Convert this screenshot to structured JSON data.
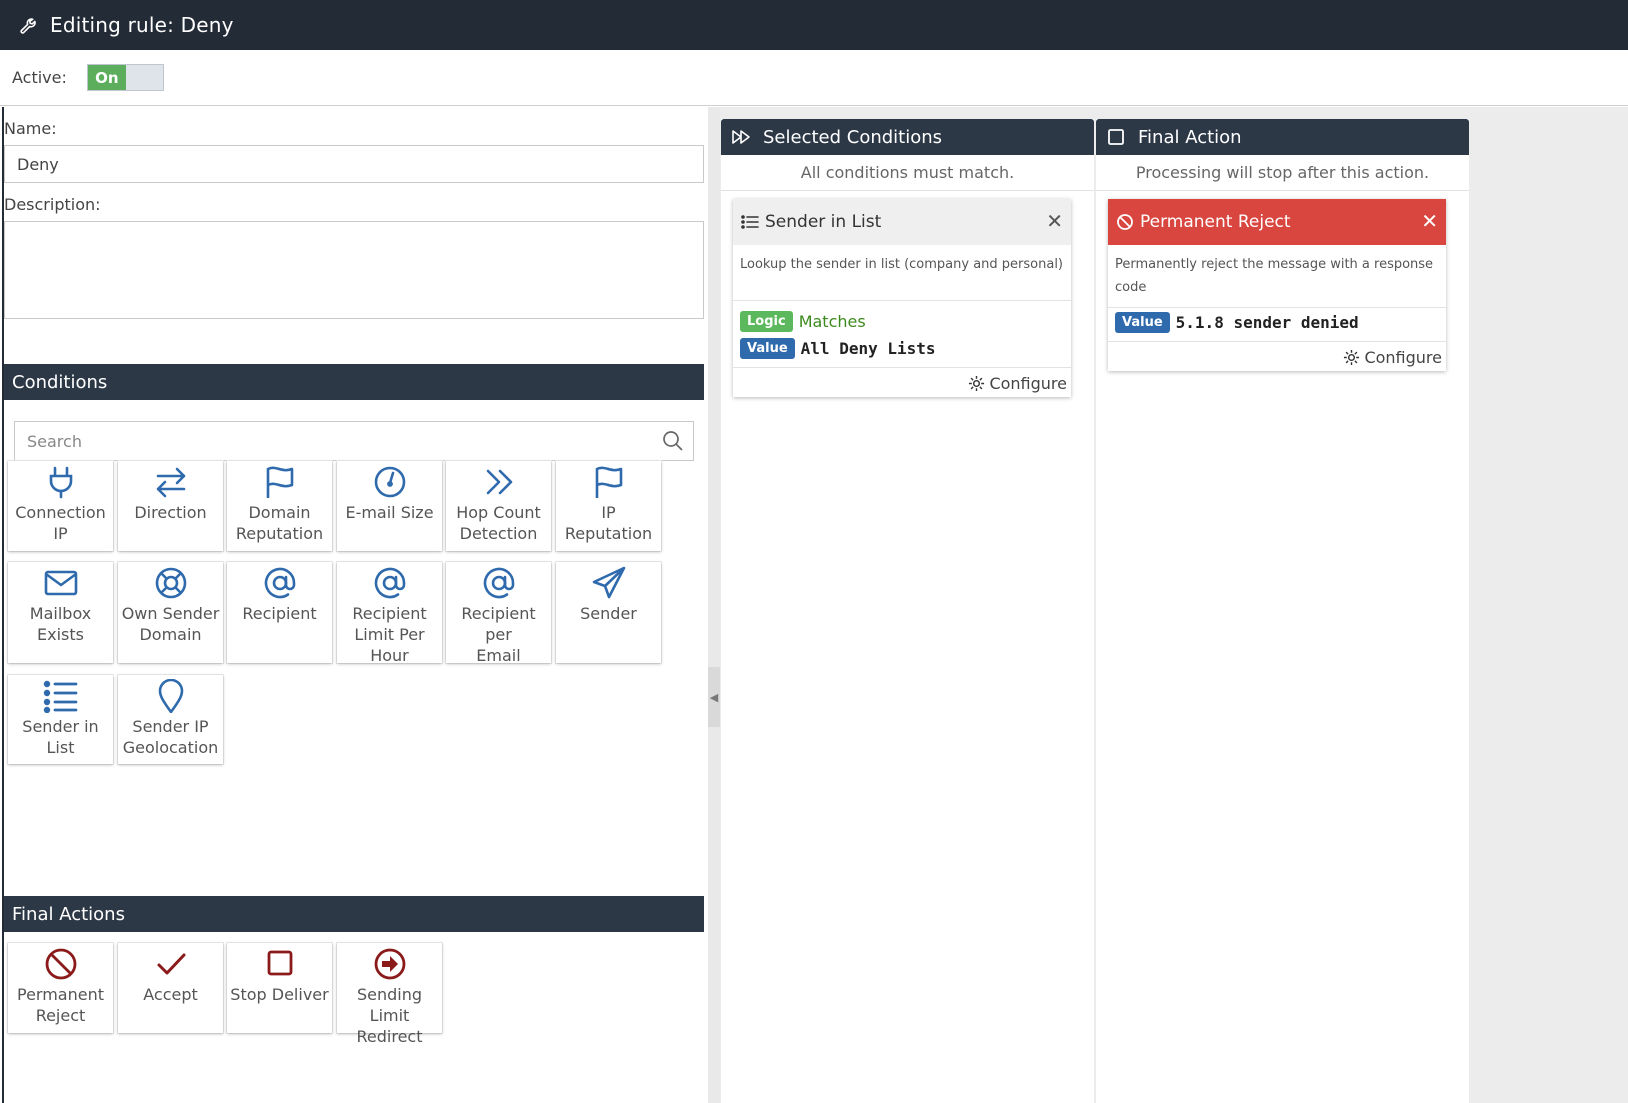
{
  "header": {
    "title": "Editing rule: Deny",
    "icon": "wrench-icon"
  },
  "active": {
    "label": "Active:",
    "toggle_on": "On"
  },
  "form": {
    "name_label": "Name:",
    "name_value": "Deny",
    "description_label": "Description:",
    "description_value": ""
  },
  "conditions": {
    "heading": "Conditions",
    "search_placeholder": "Search",
    "tiles": [
      {
        "l1": "Connection",
        "l2": "IP",
        "icon": "plug-icon"
      },
      {
        "l1": "Direction",
        "l2": "",
        "icon": "arrows-exchange-icon"
      },
      {
        "l1": "Domain",
        "l2": "Reputation",
        "icon": "flag-icon"
      },
      {
        "l1": "E-mail Size",
        "l2": "",
        "icon": "gauge-icon"
      },
      {
        "l1": "Hop Count",
        "l2": "Detection",
        "icon": "double-chevron-right-icon"
      },
      {
        "l1": "IP Reputation",
        "l2": "",
        "icon": "flag-icon"
      },
      {
        "l1": "Mailbox",
        "l2": "Exists",
        "icon": "envelope-icon"
      },
      {
        "l1": "Own Sender",
        "l2": "Domain",
        "icon": "lifebuoy-icon"
      },
      {
        "l1": "Recipient",
        "l2": "",
        "icon": "at-icon"
      },
      {
        "l1": "Recipient",
        "l2": "Limit Per",
        "l3": "Hour",
        "icon": "at-icon"
      },
      {
        "l1": "Recipient per",
        "l2": "Email",
        "icon": "at-icon"
      },
      {
        "l1": "Sender",
        "l2": "",
        "icon": "paper-plane-icon"
      },
      {
        "l1": "Sender in",
        "l2": "List",
        "icon": "list-icon"
      },
      {
        "l1": "Sender IP",
        "l2": "Geolocation",
        "icon": "map-pin-icon"
      }
    ]
  },
  "final_actions": {
    "heading": "Final Actions",
    "tiles": [
      {
        "l1": "Permanent",
        "l2": "Reject",
        "icon": "ban-icon"
      },
      {
        "l1": "Accept",
        "l2": "",
        "icon": "check-icon"
      },
      {
        "l1": "Stop Deliver",
        "l2": "",
        "icon": "square-icon"
      },
      {
        "l1": "Sending Limit",
        "l2": "Redirect",
        "icon": "arrow-circle-right-icon"
      }
    ]
  },
  "selected_conditions": {
    "heading": "Selected Conditions",
    "subtitle": "All conditions must match.",
    "card": {
      "title": "Sender in List",
      "description": "Lookup the sender in list (company and personal)",
      "logic_badge": "Logic",
      "logic_value": "Matches",
      "value_badge": "Value",
      "value": "All Deny Lists",
      "configure": "Configure"
    }
  },
  "final_action": {
    "heading": "Final Action",
    "subtitle": "Processing will stop after this action.",
    "card": {
      "title": "Permanent Reject",
      "description": "Permanently reject the message with a response code",
      "value_badge": "Value",
      "value": "5.1.8 sender denied",
      "configure": "Configure"
    }
  },
  "colors": {
    "header_bg": "#232b37",
    "section_bg": "#2d3847",
    "icon_blue": "#2f6aad",
    "icon_red": "#8b1a1a",
    "reject_red": "#d9463f",
    "logic_green": "#5cb85c",
    "matches_text": "#3c8a1d"
  }
}
